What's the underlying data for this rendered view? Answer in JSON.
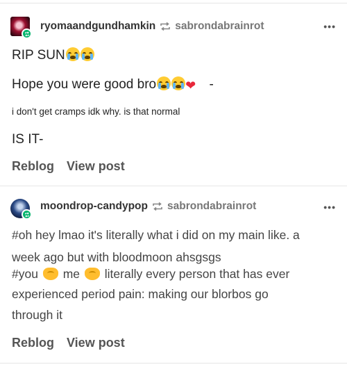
{
  "posts": [
    {
      "author": "ryomaandgundhamkin",
      "reblogged_from": "sabrondabrainrot",
      "more": "•••",
      "lines": {
        "l1": "RIP SUN",
        "l2": "Hope you were good bro",
        "l2_tail": "-",
        "l3": "i don't get cramps idk why. is that normal",
        "l4": "IS IT-"
      },
      "actions": {
        "reblog": "Reblog",
        "view": "View post"
      }
    },
    {
      "author": "moondrop-candypop",
      "reblogged_from": "sabrondabrainrot",
      "more": "•••",
      "lines": {
        "l1": "#oh hey lmao it's literally what i did on my main like. a",
        "l2": "week ago but with bloodmoon ahsgsgs",
        "l3_a": "#you",
        "l3_b": "me",
        "l3_c": "literally every person that has ever",
        "l4": "experienced period pain: making our blorbos go",
        "l5": "through it"
      },
      "actions": {
        "reblog": "Reblog",
        "view": "View post"
      }
    }
  ],
  "colors": {
    "reblog_badge": "#00b36b",
    "heart": "#e8283b"
  },
  "icons": {
    "reblog": "reblog-icon",
    "more": "more-options-icon",
    "emoji_crying": "loudly-crying-face",
    "emoji_heart": "red-heart",
    "emoji_handshake": "handshake"
  }
}
